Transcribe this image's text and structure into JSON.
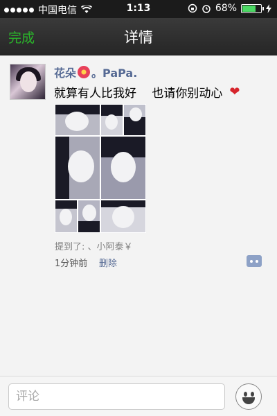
{
  "status_bar": {
    "carrier": "中国电信",
    "time": "1:13",
    "battery_percent": "68%",
    "battery_level": 0.68
  },
  "nav": {
    "back_label": "完成",
    "title": "详情"
  },
  "post": {
    "username_part1": "花朵",
    "username_part2": "。PaPa.",
    "text": "就算有人比我好　 也请你别动心",
    "heart_glyph": "❤",
    "mention": "提到了: 、小阿泰￥",
    "time": "1分钟前",
    "delete_label": "删除"
  },
  "comment_bar": {
    "placeholder": "评论"
  },
  "colors": {
    "accent_green": "#2ab52a",
    "link_blue": "#566a94",
    "nav_bg": "#2e2e2e"
  },
  "icons": {
    "wifi": "wifi-icon",
    "lock": "rotation-lock-icon",
    "alarm": "alarm-icon",
    "charging": "charging-icon",
    "comment": "comment-icon",
    "emoji": "emoji-icon"
  }
}
